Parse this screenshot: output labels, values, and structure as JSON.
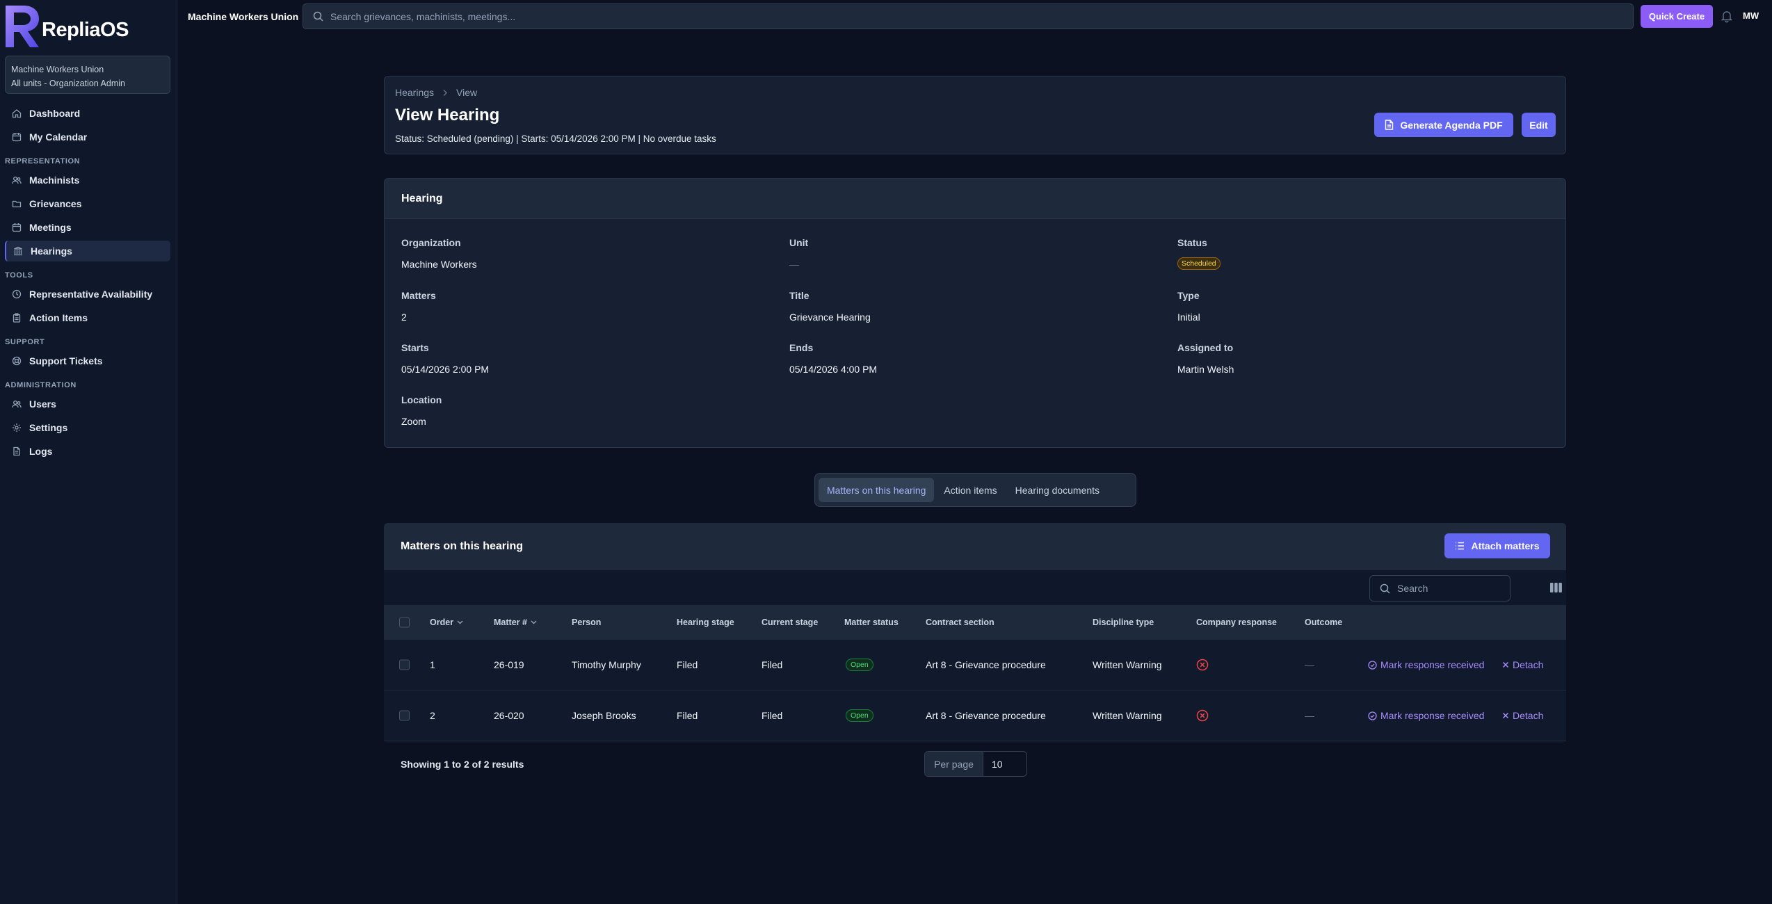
{
  "app": {
    "name": "RepliaOS",
    "org_title": "Machine Workers Union"
  },
  "org_switcher": {
    "line1": "Machine Workers Union",
    "line2": "All units - Organization Admin"
  },
  "sidebar": {
    "items": [
      {
        "label": "Dashboard",
        "icon": "home-icon"
      },
      {
        "label": "My Calendar",
        "icon": "calendar-icon"
      }
    ],
    "sections": [
      {
        "title": "REPRESENTATION",
        "items": [
          {
            "label": "Machinists",
            "icon": "users-icon"
          },
          {
            "label": "Grievances",
            "icon": "folder-icon"
          },
          {
            "label": "Meetings",
            "icon": "calendar-icon"
          },
          {
            "label": "Hearings",
            "icon": "gavel-icon",
            "active": true
          }
        ]
      },
      {
        "title": "TOOLS",
        "items": [
          {
            "label": "Representative Availability",
            "icon": "clock-icon"
          },
          {
            "label": "Action Items",
            "icon": "clipboard-icon"
          }
        ]
      },
      {
        "title": "SUPPORT",
        "items": [
          {
            "label": "Support Tickets",
            "icon": "lifebuoy-icon"
          }
        ]
      },
      {
        "title": "ADMINISTRATION",
        "items": [
          {
            "label": "Users",
            "icon": "users-icon"
          },
          {
            "label": "Settings",
            "icon": "gear-icon"
          },
          {
            "label": "Logs",
            "icon": "document-icon"
          }
        ]
      }
    ]
  },
  "topbar": {
    "search_placeholder": "Search grievances, machinists, meetings...",
    "quick_create": "Quick Create",
    "avatar_initials": "MW"
  },
  "header": {
    "breadcrumb": [
      "Hearings",
      "View"
    ],
    "title": "View Hearing",
    "status_line": "Status: Scheduled (pending) | Starts: 05/14/2026 2:00 PM | No overdue tasks",
    "generate_pdf": "Generate Agenda PDF",
    "edit": "Edit"
  },
  "hearing": {
    "section_title": "Hearing",
    "organization": {
      "label": "Organization",
      "value": "Machine Workers"
    },
    "unit": {
      "label": "Unit",
      "value": "—"
    },
    "status": {
      "label": "Status",
      "value": "Scheduled"
    },
    "matters": {
      "label": "Matters",
      "value": "2"
    },
    "title": {
      "label": "Title",
      "value": "Grievance Hearing"
    },
    "type": {
      "label": "Type",
      "value": "Initial"
    },
    "starts": {
      "label": "Starts",
      "value": "05/14/2026 2:00 PM"
    },
    "ends": {
      "label": "Ends",
      "value": "05/14/2026 4:00 PM"
    },
    "assigned_to": {
      "label": "Assigned to",
      "value": "Martin Welsh"
    },
    "location": {
      "label": "Location",
      "value": "Zoom"
    }
  },
  "tabs": [
    "Matters on this hearing",
    "Action items",
    "Hearing documents"
  ],
  "matters_table": {
    "title": "Matters on this hearing",
    "attach_button": "Attach matters",
    "search_placeholder": "Search",
    "columns": [
      "Order",
      "Matter #",
      "Person",
      "Hearing stage",
      "Current stage",
      "Matter status",
      "Contract section",
      "Discipline type",
      "Company response",
      "Outcome"
    ],
    "rows": [
      {
        "order": "1",
        "matter": "26-019",
        "person": "Timothy Murphy",
        "hearing_stage": "Filed",
        "current_stage": "Filed",
        "status": "Open",
        "contract_section": "Art 8 - Grievance procedure",
        "discipline_type": "Written Warning",
        "outcome": "—",
        "mark_action": "Mark response received",
        "detach_action": "Detach"
      },
      {
        "order": "2",
        "matter": "26-020",
        "person": "Joseph Brooks",
        "hearing_stage": "Filed",
        "current_stage": "Filed",
        "status": "Open",
        "contract_section": "Art 8 - Grievance procedure",
        "discipline_type": "Written Warning",
        "outcome": "—",
        "mark_action": "Mark response received",
        "detach_action": "Detach"
      }
    ],
    "results_text": "Showing 1 to 2 of 2 results",
    "per_page_label": "Per page",
    "per_page_value": "10"
  },
  "colors": {
    "accent": "#6366f1",
    "quick_create": "#8b5cf6",
    "background": "#0b1120",
    "sidebar": "#0f172a",
    "open_badge": "#4ade80",
    "scheduled_badge": "#fcd34d",
    "response_missing": "#ef4444"
  }
}
